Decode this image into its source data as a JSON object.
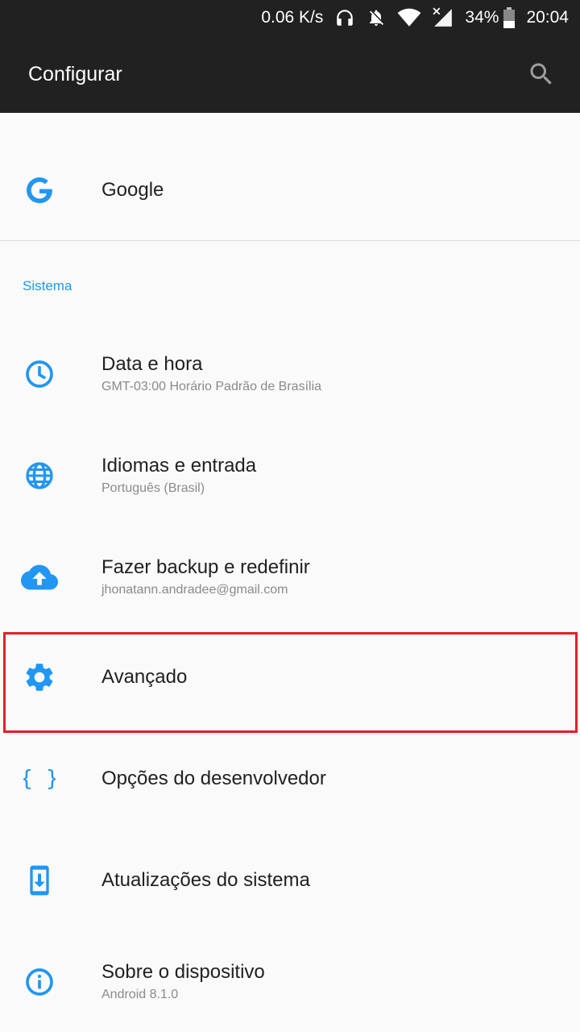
{
  "status_bar": {
    "speed": "0.06 K/s",
    "battery": "34%",
    "time": "20:04"
  },
  "app_bar": {
    "title": "Configurar",
    "search_icon": "search-icon"
  },
  "google": {
    "label": "Google",
    "icon": "google-icon"
  },
  "section": {
    "title": "Sistema"
  },
  "items": [
    {
      "label": "Data e hora",
      "summary": "GMT-03:00 Horário Padrão de Brasília",
      "icon": "clock-icon"
    },
    {
      "label": "Idiomas e entrada",
      "summary": "Português (Brasil)",
      "icon": "globe-icon"
    },
    {
      "label": "Fazer backup e redefinir",
      "summary": "jhonatann.andradee@gmail.com",
      "icon": "cloud-upload-icon"
    },
    {
      "label": "Avançado",
      "summary": "",
      "icon": "gear-icon"
    },
    {
      "label": "Opções do desenvolvedor",
      "summary": "",
      "icon": "braces-icon"
    },
    {
      "label": "Atualizações do sistema",
      "summary": "",
      "icon": "system-update-icon"
    },
    {
      "label": "Sobre o dispositivo",
      "summary": "Android 8.1.0",
      "icon": "info-icon"
    }
  ],
  "colors": {
    "accent": "#2196f3",
    "toolbar": "#212121",
    "highlight": "#e0202a"
  }
}
